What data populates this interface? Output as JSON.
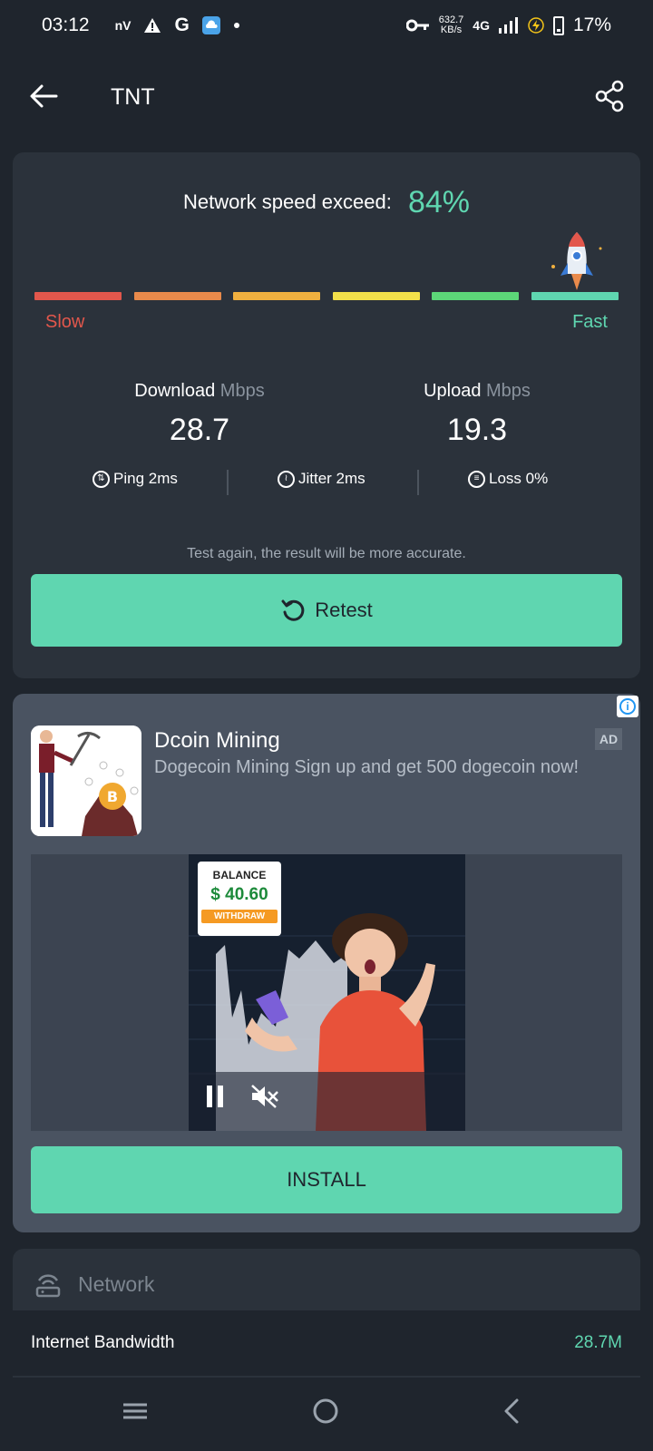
{
  "status_bar": {
    "time": "03:12",
    "notif_nv": "nV",
    "notif_g": "G",
    "net_rate_value": "632.7",
    "net_rate_unit": "KB/s",
    "network_type": "4G",
    "battery": "17%"
  },
  "app_bar": {
    "title": "TNT"
  },
  "result": {
    "speed_label": "Network speed exceed:",
    "speed_value": "84%",
    "scale_colors": [
      "#e2574c",
      "#e98a4b",
      "#f0b03f",
      "#f2e04a",
      "#5cd778",
      "#5fd6b0"
    ],
    "slow_label": "Slow",
    "fast_label": "Fast",
    "download_label": "Download",
    "download_unit": "Mbps",
    "download_value": "28.7",
    "upload_label": "Upload",
    "upload_unit": "Mbps",
    "upload_value": "19.3",
    "ping_label": "Ping 2ms",
    "jitter_label": "Jitter 2ms",
    "loss_label": "Loss 0%",
    "hint": "Test again, the result will be more accurate.",
    "retest_label": "Retest"
  },
  "ad": {
    "title": "Dcoin Mining",
    "description": "Dogecoin Mining Sign up and get 500 dogecoin now!",
    "badge": "AD",
    "balance_title": "BALANCE",
    "balance_value": "$ 40.60",
    "withdraw_label": "WITHDRAW",
    "install_label": "INSTALL"
  },
  "network": {
    "section_title": "Network",
    "rows": [
      {
        "label": "Internet Bandwidth",
        "value": "28.7M"
      }
    ]
  },
  "colors": {
    "accent": "#5fd6b0",
    "background": "#1f252d",
    "card": "#2b323b",
    "ad_card": "#4a5361"
  }
}
